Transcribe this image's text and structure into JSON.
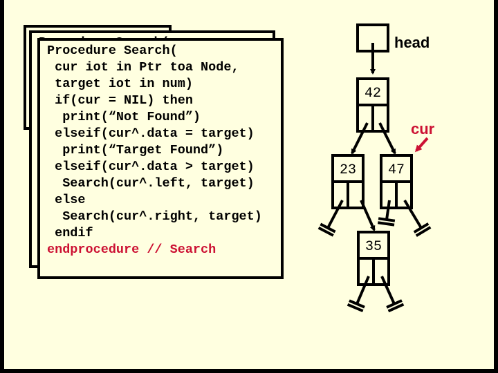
{
  "slide": {
    "back_box_1_text": "Procedure Search(",
    "back_box_2_text": "Procedure Search(",
    "code_lines": [
      {
        "text": "Procedure Search(",
        "indent": 0,
        "red": false
      },
      {
        "text": " cur iot in Ptr toa Node,",
        "indent": 1,
        "red": false
      },
      {
        "text": " target iot in num)",
        "indent": 1,
        "red": false
      },
      {
        "text": " if(cur = NIL) then",
        "indent": 1,
        "red": false
      },
      {
        "text": "  print(“Not Found”)",
        "indent": 2,
        "red": false
      },
      {
        "text": " elseif(cur^.data = target)",
        "indent": 1,
        "red": false
      },
      {
        "text": "  print(“Target Found”)",
        "indent": 2,
        "red": false
      },
      {
        "text": " elseif(cur^.data > target)",
        "indent": 1,
        "red": false
      },
      {
        "text": "  Search(cur^.left, target)",
        "indent": 2,
        "red": false
      },
      {
        "text": " else",
        "indent": 1,
        "red": false
      },
      {
        "text": "  Search(cur^.right, target)",
        "indent": 2,
        "red": false
      },
      {
        "text": " endif",
        "indent": 1,
        "red": false
      },
      {
        "text": "endprocedure // Search",
        "indent": 0,
        "red": true
      }
    ]
  },
  "tree": {
    "head_label": "head",
    "cur_label": "cur",
    "nodes": {
      "root": "42",
      "left": "23",
      "right": "47",
      "left_right": "35"
    },
    "colors": {
      "pointer_label": "#cc1133",
      "lines": "#000000",
      "background": "#ffffe0"
    }
  }
}
